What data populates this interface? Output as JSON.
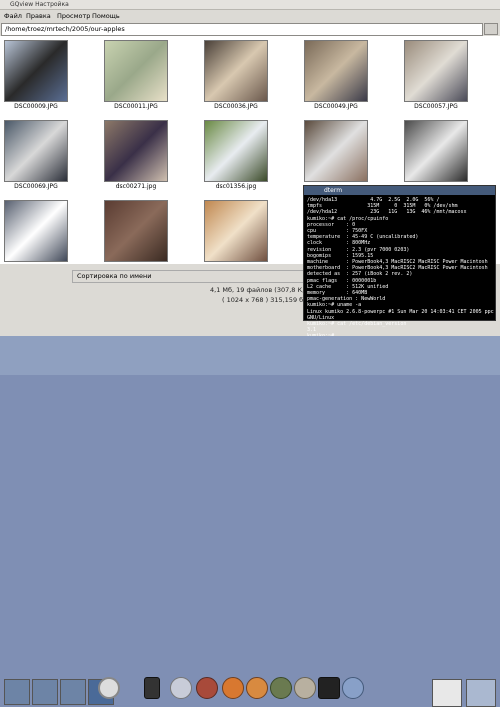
{
  "window": {
    "title": "GQview Настройка"
  },
  "menu": {
    "items": [
      "Файл",
      "Правка",
      "Просмотр",
      "Помощь"
    ]
  },
  "path": {
    "value": "/home/troez/mrtech/2005/our-apples"
  },
  "thumbnails": [
    {
      "caption": "DSC00009.JPG",
      "colors": [
        "#b8c4d6",
        "#2a2a2a",
        "#5a6e94"
      ]
    },
    {
      "caption": "DSC00011.JPG",
      "colors": [
        "#c8d2b0",
        "#9aa88a",
        "#e8e0c8"
      ]
    },
    {
      "caption": "DSC00036.JPG",
      "colors": [
        "#4a4038",
        "#d8c8b0",
        "#6a584c"
      ]
    },
    {
      "caption": "DSC00049.JPG",
      "colors": [
        "#7a6a58",
        "#c8b8a0",
        "#3a3a48"
      ]
    },
    {
      "caption": "DSC00057.JPG",
      "colors": [
        "#9a8c7c",
        "#e0dcd4",
        "#4a4a58"
      ]
    },
    {
      "caption": "DSC00069.JPG",
      "colors": [
        "#4a5868",
        "#d8d8d8",
        "#2a2e38"
      ]
    },
    {
      "caption": "dsc00271.jpg",
      "colors": [
        "#8c7868",
        "#3a3048",
        "#d0c0b0"
      ]
    },
    {
      "caption": "dsc01356.jpg",
      "colors": [
        "#6a8a44",
        "#e8ecf0",
        "#3a4a28"
      ]
    },
    {
      "caption": "",
      "colors": [
        "#5a4a3c",
        "#e0e0e0",
        "#8a7060"
      ]
    },
    {
      "caption": "",
      "colors": [
        "#4a4a4a",
        "#e8e8e8",
        "#2a2a2a"
      ]
    },
    {
      "caption": "",
      "colors": [
        "#586070",
        "#ffffff",
        "#404858"
      ]
    },
    {
      "caption": "",
      "colors": [
        "#5a3c32",
        "#8a6a5a",
        "#3a2a22"
      ]
    },
    {
      "caption": "",
      "colors": [
        "#c08850",
        "#f0e0c8",
        "#705040"
      ]
    },
    {
      "caption": "",
      "colors": [
        "#6a6a6a",
        "#dcdcdc",
        "#3a3a3a"
      ]
    },
    {
      "caption": "",
      "colors": [
        "#6a6a6a",
        "#e8e8e8",
        "#3a3a3a"
      ]
    }
  ],
  "sort": {
    "label": "Сортировка по имени"
  },
  "status": {
    "files": "4,1 Мб, 19 файлов (307,8 К, 1)",
    "image_info": "( 1024 x 768 ) 315,159 байт"
  },
  "terminal": {
    "title": "dterm",
    "lines": [
      "/dev/hda13           4.7G  2.5G  2.0G  56% /",
      "tmpfs               315M     0  315M   0% /dev/shm",
      "/dev/hda12           23G   11G   13G  46% /mnt/macosx",
      "kumiko:~# cat /proc/cpuinfo",
      "processor    : 0",
      "cpu          : 750FX",
      "temperature  : 45-49 C (uncalibrated)",
      "clock        : 800MHz",
      "revision     : 2.3 (pvr 7000 0203)",
      "bogomips     : 1595.15",
      "machine      : PowerBook4,3 MacRISC2 MacRISC Power Macintosh",
      "motherboard  : PowerBook4,3 MacRISC2 MacRISC Power Macintosh",
      "detected as  : 257 (iBook 2 rev. 2)",
      "pmac flags   : 0000001b",
      "L2 cache     : 512K unified",
      "memory       : 640MB",
      "pmac-generation : NewWorld",
      "kumiko:~# uname -a",
      "Linux kumiko 2.6.8-powerpc #1 Sun Mar 20 14:03:41 CET 2005 ppc",
      "GNU/Linux",
      "kumiko:~# cat /etc/debian_version",
      "3.1",
      "kumiko:~# "
    ]
  },
  "panel": {
    "workspaces": [
      "workspace-1",
      "workspace-2",
      "workspace-3",
      "workspace-4"
    ],
    "launchers": [
      "clock-icon",
      "trash-icon",
      "pin-icon",
      "gnome-foot-icon",
      "firefox-icon",
      "gaim-icon",
      "mail-icon",
      "script-icon",
      "terminal-icon",
      "file-manager-icon"
    ]
  }
}
